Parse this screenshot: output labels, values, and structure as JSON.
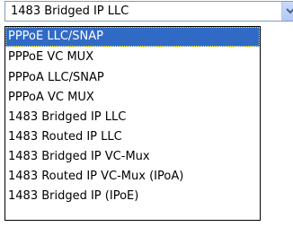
{
  "select": {
    "current_value": "1483 Bridged IP LLC",
    "arrow_icon": "chevron-down-icon",
    "options": [
      "PPPoE LLC/SNAP",
      "PPPoE VC MUX",
      "PPPoA LLC/SNAP",
      "PPPoA VC MUX",
      "1483 Bridged IP LLC",
      "1483 Routed IP LLC",
      "1483 Bridged IP VC-Mux",
      "1483 Routed IP VC-Mux (IPoA)",
      "1483 Bridged IP (IPoE)"
    ],
    "highlighted_option": "PPPoE LLC/SNAP"
  },
  "colors": {
    "highlight": "#316ac5",
    "border": "#7f9db9"
  }
}
